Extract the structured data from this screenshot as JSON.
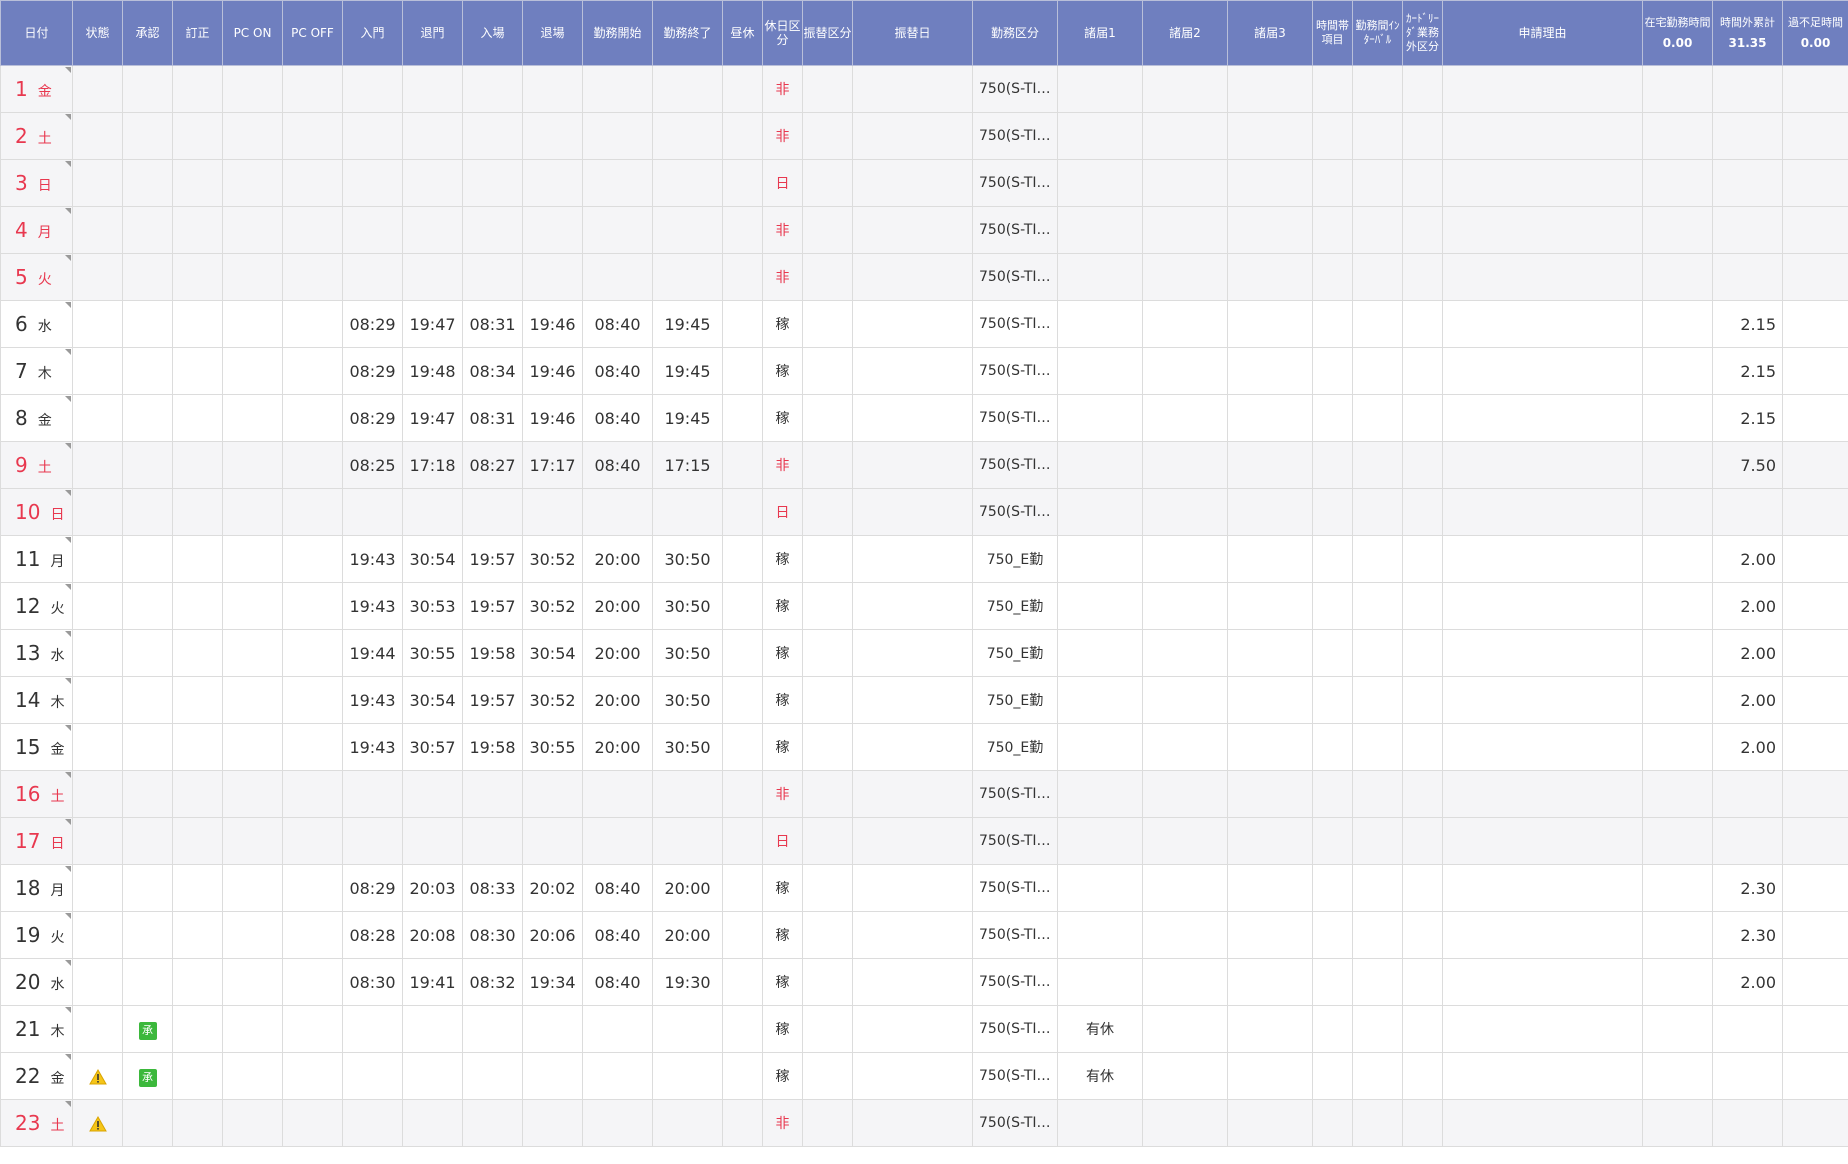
{
  "headers": {
    "date": "日付",
    "status": "状態",
    "approve": "承認",
    "correct": "訂正",
    "pc_on": "PC ON",
    "pc_off": "PC OFF",
    "gate_in": "入門",
    "gate_out": "退門",
    "enter": "入場",
    "exit": "退場",
    "work_start": "勤務開始",
    "work_end": "勤務終了",
    "lunch": "昼休",
    "holiday_type": "休日区分",
    "substitute_type": "振替区分",
    "substitute_date": "振替日",
    "work_category": "勤務区分",
    "notice1": "諸届1",
    "notice2": "諸届2",
    "notice3": "諸届3",
    "time_item": "時間帯項目",
    "interval": "勤務間ｲﾝﾀｰﾊﾞﾙ",
    "card_reader": "ｶｰﾄﾞﾘｰﾀﾞ業務外区分",
    "reason": "申請理由",
    "home_work": "在宅勤務時間",
    "overtime_total": "時間外累計",
    "excess_shortage": "過不足時間"
  },
  "totals": {
    "home_work": "0.00",
    "overtime_total": "31.35",
    "excess_shortage": "0.00"
  },
  "colors": {
    "header_bg": "#6f7fbf",
    "holiday_red": "#e8384f",
    "approve_green": "#3cb83c",
    "warning_yellow": "#f5c518"
  },
  "rows": [
    {
      "day": "1",
      "weekday": "金",
      "red": true,
      "gray": true,
      "status": "",
      "approve": "",
      "gate_in": "",
      "gate_out": "",
      "enter": "",
      "exit": "",
      "start": "",
      "end": "",
      "holiday": "非",
      "category": "750(S-TI…",
      "notice1": "",
      "overtime": ""
    },
    {
      "day": "2",
      "weekday": "土",
      "red": true,
      "gray": true,
      "status": "",
      "approve": "",
      "gate_in": "",
      "gate_out": "",
      "enter": "",
      "exit": "",
      "start": "",
      "end": "",
      "holiday": "非",
      "category": "750(S-TI…",
      "notice1": "",
      "overtime": ""
    },
    {
      "day": "3",
      "weekday": "日",
      "red": true,
      "gray": true,
      "status": "",
      "approve": "",
      "gate_in": "",
      "gate_out": "",
      "enter": "",
      "exit": "",
      "start": "",
      "end": "",
      "holiday": "日",
      "category": "750(S-TI…",
      "notice1": "",
      "overtime": ""
    },
    {
      "day": "4",
      "weekday": "月",
      "red": true,
      "gray": true,
      "status": "",
      "approve": "",
      "gate_in": "",
      "gate_out": "",
      "enter": "",
      "exit": "",
      "start": "",
      "end": "",
      "holiday": "非",
      "category": "750(S-TI…",
      "notice1": "",
      "overtime": ""
    },
    {
      "day": "5",
      "weekday": "火",
      "red": true,
      "gray": true,
      "status": "",
      "approve": "",
      "gate_in": "",
      "gate_out": "",
      "enter": "",
      "exit": "",
      "start": "",
      "end": "",
      "holiday": "非",
      "category": "750(S-TI…",
      "notice1": "",
      "overtime": ""
    },
    {
      "day": "6",
      "weekday": "水",
      "red": false,
      "gray": false,
      "status": "",
      "approve": "",
      "gate_in": "08:29",
      "gate_out": "19:47",
      "enter": "08:31",
      "exit": "19:46",
      "start": "08:40",
      "end": "19:45",
      "holiday": "稼",
      "category": "750(S-TI…",
      "notice1": "",
      "overtime": "2.15"
    },
    {
      "day": "7",
      "weekday": "木",
      "red": false,
      "gray": false,
      "status": "",
      "approve": "",
      "gate_in": "08:29",
      "gate_out": "19:48",
      "enter": "08:34",
      "exit": "19:46",
      "start": "08:40",
      "end": "19:45",
      "holiday": "稼",
      "category": "750(S-TI…",
      "notice1": "",
      "overtime": "2.15"
    },
    {
      "day": "8",
      "weekday": "金",
      "red": false,
      "gray": false,
      "status": "",
      "approve": "",
      "gate_in": "08:29",
      "gate_out": "19:47",
      "enter": "08:31",
      "exit": "19:46",
      "start": "08:40",
      "end": "19:45",
      "holiday": "稼",
      "category": "750(S-TI…",
      "notice1": "",
      "overtime": "2.15"
    },
    {
      "day": "9",
      "weekday": "土",
      "red": true,
      "gray": true,
      "status": "",
      "approve": "",
      "gate_in": "08:25",
      "gate_out": "17:18",
      "enter": "08:27",
      "exit": "17:17",
      "start": "08:40",
      "end": "17:15",
      "holiday": "非",
      "category": "750(S-TI…",
      "notice1": "",
      "overtime": "7.50"
    },
    {
      "day": "10",
      "weekday": "日",
      "red": true,
      "gray": true,
      "status": "",
      "approve": "",
      "gate_in": "",
      "gate_out": "",
      "enter": "",
      "exit": "",
      "start": "",
      "end": "",
      "holiday": "日",
      "category": "750(S-TI…",
      "notice1": "",
      "overtime": ""
    },
    {
      "day": "11",
      "weekday": "月",
      "red": false,
      "gray": false,
      "status": "",
      "approve": "",
      "gate_in": "19:43",
      "gate_out": "30:54",
      "enter": "19:57",
      "exit": "30:52",
      "start": "20:00",
      "end": "30:50",
      "holiday": "稼",
      "category": "750_E勤",
      "notice1": "",
      "overtime": "2.00"
    },
    {
      "day": "12",
      "weekday": "火",
      "red": false,
      "gray": false,
      "status": "",
      "approve": "",
      "gate_in": "19:43",
      "gate_out": "30:53",
      "enter": "19:57",
      "exit": "30:52",
      "start": "20:00",
      "end": "30:50",
      "holiday": "稼",
      "category": "750_E勤",
      "notice1": "",
      "overtime": "2.00"
    },
    {
      "day": "13",
      "weekday": "水",
      "red": false,
      "gray": false,
      "status": "",
      "approve": "",
      "gate_in": "19:44",
      "gate_out": "30:55",
      "enter": "19:58",
      "exit": "30:54",
      "start": "20:00",
      "end": "30:50",
      "holiday": "稼",
      "category": "750_E勤",
      "notice1": "",
      "overtime": "2.00"
    },
    {
      "day": "14",
      "weekday": "木",
      "red": false,
      "gray": false,
      "status": "",
      "approve": "",
      "gate_in": "19:43",
      "gate_out": "30:54",
      "enter": "19:57",
      "exit": "30:52",
      "start": "20:00",
      "end": "30:50",
      "holiday": "稼",
      "category": "750_E勤",
      "notice1": "",
      "overtime": "2.00"
    },
    {
      "day": "15",
      "weekday": "金",
      "red": false,
      "gray": false,
      "status": "",
      "approve": "",
      "gate_in": "19:43",
      "gate_out": "30:57",
      "enter": "19:58",
      "exit": "30:55",
      "start": "20:00",
      "end": "30:50",
      "holiday": "稼",
      "category": "750_E勤",
      "notice1": "",
      "overtime": "2.00"
    },
    {
      "day": "16",
      "weekday": "土",
      "red": true,
      "gray": true,
      "status": "",
      "approve": "",
      "gate_in": "",
      "gate_out": "",
      "enter": "",
      "exit": "",
      "start": "",
      "end": "",
      "holiday": "非",
      "category": "750(S-TI…",
      "notice1": "",
      "overtime": ""
    },
    {
      "day": "17",
      "weekday": "日",
      "red": true,
      "gray": true,
      "status": "",
      "approve": "",
      "gate_in": "",
      "gate_out": "",
      "enter": "",
      "exit": "",
      "start": "",
      "end": "",
      "holiday": "日",
      "category": "750(S-TI…",
      "notice1": "",
      "overtime": ""
    },
    {
      "day": "18",
      "weekday": "月",
      "red": false,
      "gray": false,
      "status": "",
      "approve": "",
      "gate_in": "08:29",
      "gate_out": "20:03",
      "enter": "08:33",
      "exit": "20:02",
      "start": "08:40",
      "end": "20:00",
      "holiday": "稼",
      "category": "750(S-TI…",
      "notice1": "",
      "overtime": "2.30"
    },
    {
      "day": "19",
      "weekday": "火",
      "red": false,
      "gray": false,
      "status": "",
      "approve": "",
      "gate_in": "08:28",
      "gate_out": "20:08",
      "enter": "08:30",
      "exit": "20:06",
      "start": "08:40",
      "end": "20:00",
      "holiday": "稼",
      "category": "750(S-TI…",
      "notice1": "",
      "overtime": "2.30"
    },
    {
      "day": "20",
      "weekday": "水",
      "red": false,
      "gray": false,
      "status": "",
      "approve": "",
      "gate_in": "08:30",
      "gate_out": "19:41",
      "enter": "08:32",
      "exit": "19:34",
      "start": "08:40",
      "end": "19:30",
      "holiday": "稼",
      "category": "750(S-TI…",
      "notice1": "",
      "overtime": "2.00"
    },
    {
      "day": "21",
      "weekday": "木",
      "red": false,
      "gray": false,
      "status": "",
      "approve": "承",
      "gate_in": "",
      "gate_out": "",
      "enter": "",
      "exit": "",
      "start": "",
      "end": "",
      "holiday": "稼",
      "category": "750(S-TI…",
      "notice1": "有休",
      "overtime": ""
    },
    {
      "day": "22",
      "weekday": "金",
      "red": false,
      "gray": false,
      "status": "warning",
      "approve": "承",
      "gate_in": "",
      "gate_out": "",
      "enter": "",
      "exit": "",
      "start": "",
      "end": "",
      "holiday": "稼",
      "category": "750(S-TI…",
      "notice1": "有休",
      "overtime": ""
    },
    {
      "day": "23",
      "weekday": "土",
      "red": true,
      "gray": true,
      "status": "warning",
      "approve": "",
      "gate_in": "",
      "gate_out": "",
      "enter": "",
      "exit": "",
      "start": "",
      "end": "",
      "holiday": "非",
      "category": "750(S-TI…",
      "notice1": "",
      "overtime": ""
    }
  ]
}
